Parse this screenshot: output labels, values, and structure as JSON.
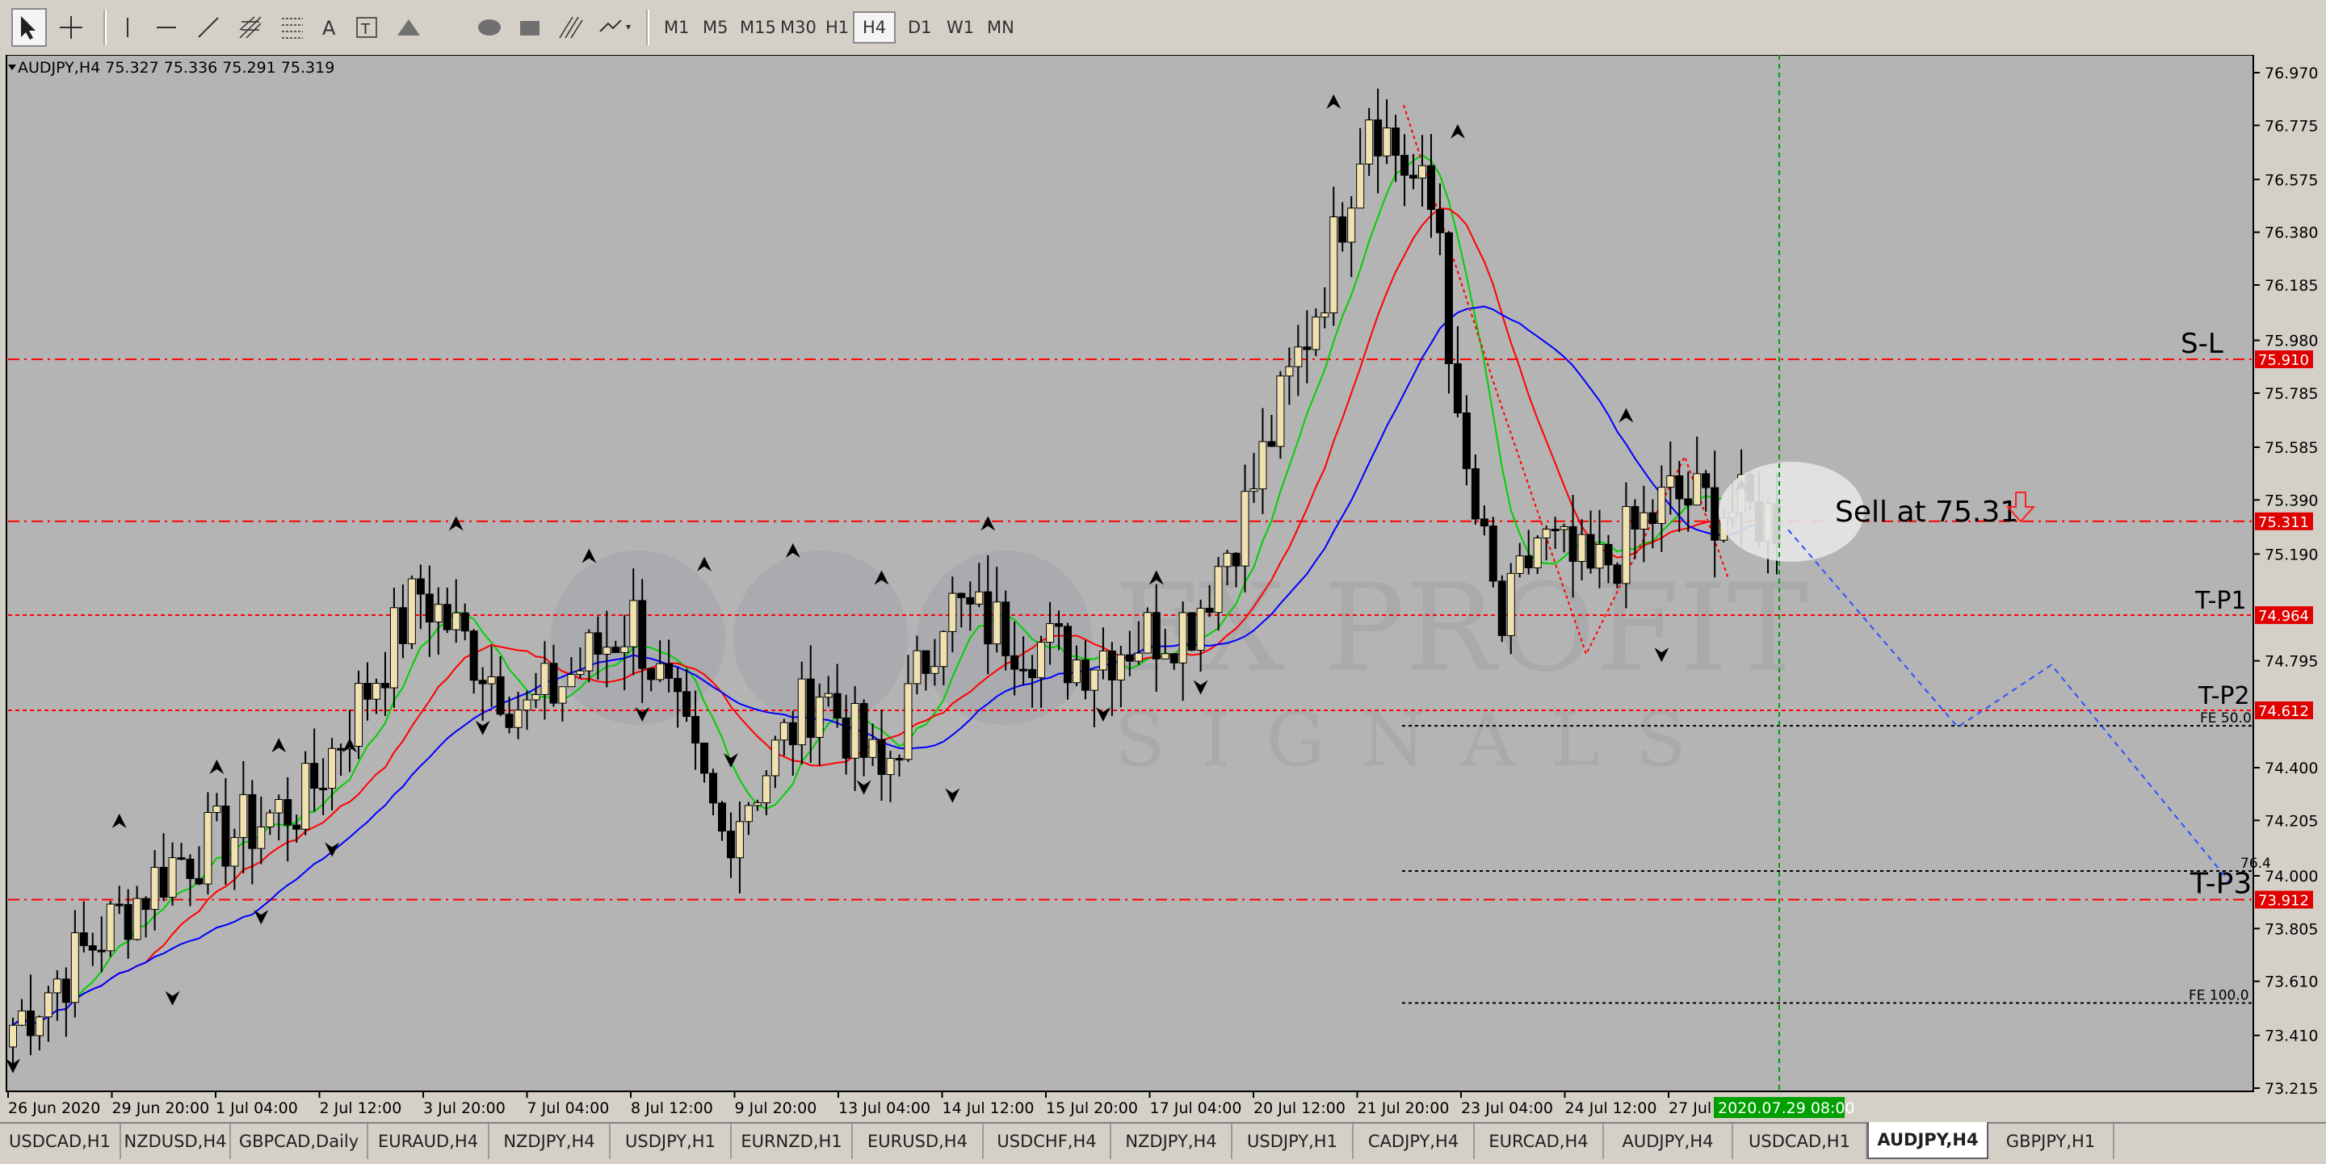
{
  "toolbar": {
    "tools": [
      {
        "name": "cursor-icon"
      },
      {
        "name": "crosshair-icon"
      },
      {
        "name": "vertical-line-icon"
      },
      {
        "name": "horizontal-line-icon"
      },
      {
        "name": "trendline-icon"
      },
      {
        "name": "equidistant-channel-icon"
      },
      {
        "name": "fibonacci-icon"
      },
      {
        "name": "text-icon"
      },
      {
        "name": "text-label-icon"
      },
      {
        "name": "triangle-icon"
      },
      {
        "name": "ellipse-icon"
      },
      {
        "name": "rectangle-icon"
      },
      {
        "name": "channel-lines-icon"
      },
      {
        "name": "arrows-icon"
      }
    ],
    "timeframes": [
      "M1",
      "M5",
      "M15",
      "M30",
      "H1",
      "H4",
      "D1",
      "W1",
      "MN"
    ],
    "active_timeframe": "H4"
  },
  "chart": {
    "header": "AUDJPY,H4  75.327 75.336 75.291 75.319",
    "price_labels": [
      "76.970",
      "76.775",
      "76.575",
      "76.380",
      "76.185",
      "75.980",
      "75.785",
      "75.585",
      "75.390",
      "75.190",
      "74.795",
      "74.400",
      "74.205",
      "74.000",
      "73.805",
      "73.610",
      "73.410",
      "73.215"
    ],
    "time_labels": [
      "26 Jun 2020",
      "29 Jun 20:00",
      "1 Jul 04:00",
      "2 Jul 12:00",
      "3 Jul 20:00",
      "7 Jul 04:00",
      "8 Jul 12:00",
      "9 Jul 20:00",
      "13 Jul 04:00",
      "14 Jul 12:00",
      "15 Jul 20:00",
      "17 Jul 04:00",
      "20 Jul 12:00",
      "21 Jul 20:00",
      "23 Jul 04:00",
      "24 Jul 12:00",
      "27 Jul 20:00"
    ],
    "cursor_time_label": "2020.07.29 08:00",
    "levels": [
      {
        "label": "S-L",
        "price": 75.91,
        "price_label": "75.910"
      },
      {
        "label": "",
        "price": 75.311,
        "price_label": "75.311"
      },
      {
        "label": "T-P1",
        "price": 74.964,
        "price_label": "74.964"
      },
      {
        "label": "T-P2",
        "price": 74.612,
        "price_label": "74.612"
      },
      {
        "label": "T-P3",
        "price": 73.912,
        "price_label": "73.912"
      }
    ],
    "fibo_labels": [
      "FE 50.0",
      "76.4",
      "FE 100.0"
    ],
    "annotation": "Sell at 75.31",
    "watermark_top": "FX PROFIT",
    "watermark_bottom": "SIGNALS",
    "colors": {
      "background": "#b4b4b4",
      "bull_candle": "#f0e2b0",
      "bear_candle": "#000000",
      "ma_fast": "#00d000",
      "ma_mid": "#ff0000",
      "ma_slow": "#0000ff",
      "level_line": "#ff0000",
      "price_tag": "#e00000",
      "time_tag": "#00a000",
      "cursor_line": "#00a000"
    }
  },
  "chart_data": {
    "type": "candlestick",
    "title": "AUDJPY,H4",
    "ylim": [
      73.215,
      76.97
    ],
    "key_points": [
      {
        "time": "26 Jun 2020",
        "price": 73.5
      },
      {
        "time": "29 Jun 20:00",
        "price": 74.05
      },
      {
        "time": "3 Jul 20:00",
        "price": 75.0
      },
      {
        "time": "9 Jul 20:00",
        "price": 74.2
      },
      {
        "time": "14 Jul 12:00",
        "price": 75.05
      },
      {
        "time": "21 Jul 20:00",
        "price": 76.8
      },
      {
        "time": "24 Jul 12:00",
        "price": 74.9
      },
      {
        "time": "2020.07.29 08:00",
        "price": 75.319
      }
    ]
  },
  "tabs": [
    "USDCAD,H1",
    "NZDUSD,H4",
    "GBPCAD,Daily",
    "EURAUD,H4",
    "NZDJPY,H4",
    "USDJPY,H1",
    "EURNZD,H1",
    "EURUSD,H4",
    "USDCHF,H4",
    "NZDJPY,H4",
    "USDJPY,H1",
    "CADJPY,H4",
    "EURCAD,H4",
    "AUDJPY,H4",
    "USDCAD,H1",
    "AUDJPY,H4",
    "GBPJPY,H1"
  ],
  "active_tab_index": 15
}
